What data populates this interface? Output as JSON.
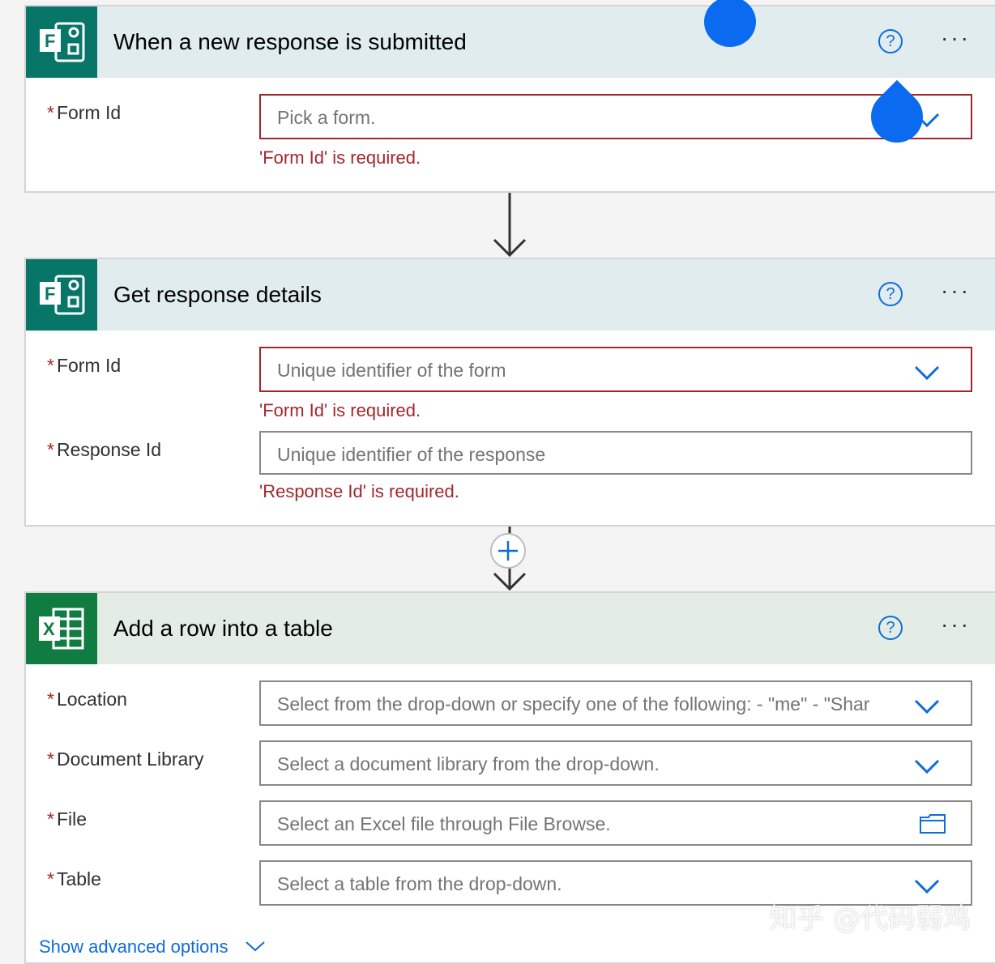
{
  "cards": [
    {
      "title": "When a new response is submitted",
      "app": "microsoft-forms-icon",
      "fields": [
        {
          "label": "Form Id",
          "placeholder": "Pick a form.",
          "error": "'Form Id' is required."
        }
      ]
    },
    {
      "title": "Get response details",
      "app": "microsoft-forms-icon",
      "fields": [
        {
          "label": "Form Id",
          "placeholder": "Unique identifier of the form",
          "error": "'Form Id' is required."
        },
        {
          "label": "Response Id",
          "placeholder": "Unique identifier of the response",
          "error": "'Response Id' is required."
        }
      ]
    },
    {
      "title": "Add a row into a table",
      "app": "excel-icon",
      "fields": [
        {
          "label": "Location",
          "placeholder": "Select from the drop-down or specify one of the following: - \"me\" - \"Shar"
        },
        {
          "label": "Document Library",
          "placeholder": "Select a document library from the drop-down."
        },
        {
          "label": "File",
          "placeholder": "Select an Excel file through File Browse."
        },
        {
          "label": "Table",
          "placeholder": "Select a table from the drop-down."
        }
      ]
    }
  ],
  "common": {
    "required_mark": "*",
    "help_glyph": "?",
    "more_glyph": "···"
  },
  "advanced_options": "Show advanced options",
  "watermark": "知乎 @代码弱鸡",
  "colors": {
    "forms_brand": "#077568",
    "excel_brand": "#107c41",
    "error": "#a4262c",
    "accent": "#0f6cd8"
  }
}
